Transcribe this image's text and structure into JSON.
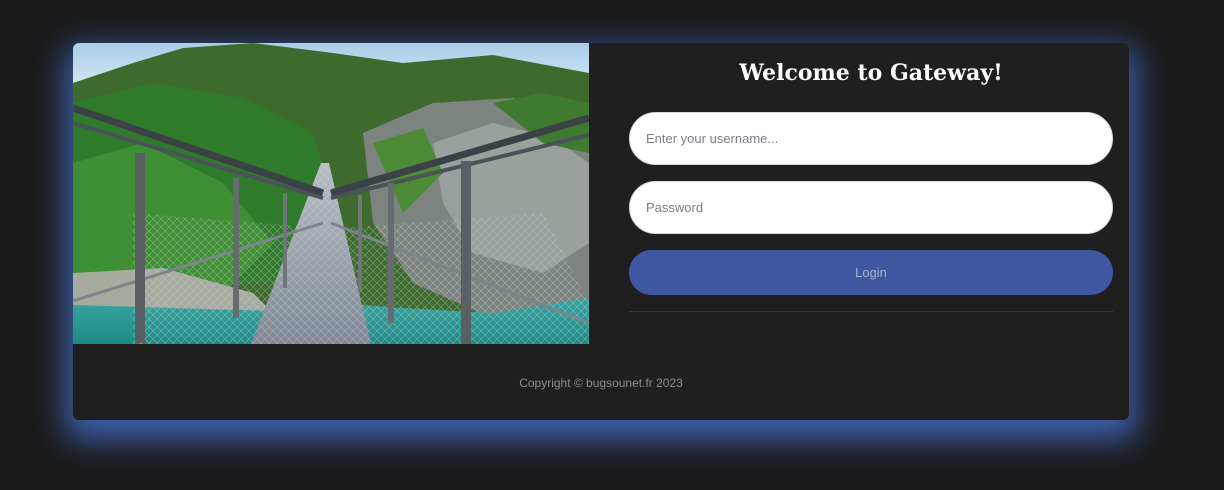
{
  "login": {
    "title": "Welcome to Gateway!",
    "username_placeholder": "Enter your username...",
    "password_placeholder": "Password",
    "login_label": "Login"
  },
  "footer": {
    "copyright": "Copyright © bugsounet.fr 2023"
  },
  "colors": {
    "page_background": "#1b1b1c",
    "card_background": "#1f1f20",
    "glow": "#4876d6",
    "button": "#3f56a0"
  }
}
